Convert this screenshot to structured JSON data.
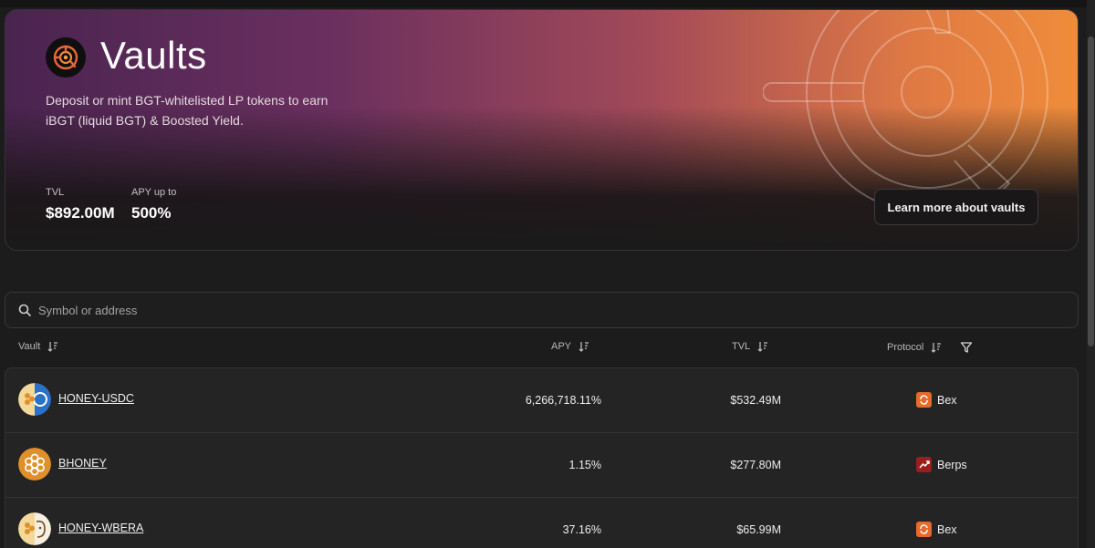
{
  "hero": {
    "title": "Vaults",
    "description": "Deposit or mint BGT-whitelisted LP tokens to earn iBGT (liquid BGT) & Boosted Yield.",
    "stats": [
      {
        "label": "TVL",
        "value": "$892.00M"
      },
      {
        "label": "APY up to",
        "value": "500%"
      }
    ],
    "learn_more_label": "Learn more about vaults",
    "logo_icon": "target-icon"
  },
  "search": {
    "placeholder": "Symbol or address",
    "value": ""
  },
  "table": {
    "columns": [
      {
        "label": "Vault",
        "icon": "sort-icon"
      },
      {
        "label": "APY",
        "icon": "sort-icon"
      },
      {
        "label": "TVL",
        "icon": "sort-icon"
      },
      {
        "label": "Protocol",
        "icon": "sort-icon",
        "extra_icon": "filter-icon"
      }
    ],
    "rows": [
      {
        "vault": "HONEY-USDC",
        "apy": "6,266,718.11%",
        "tvl": "$532.49M",
        "protocol": "Bex",
        "protocol_icon": "bex-icon",
        "protocol_color": "#e56a2c"
      },
      {
        "vault": "BHONEY",
        "apy": "1.15%",
        "tvl": "$277.80M",
        "protocol": "Berps",
        "protocol_icon": "berps-icon",
        "protocol_color": "#9b1d1d"
      },
      {
        "vault": "HONEY-WBERA",
        "apy": "37.16%",
        "tvl": "$65.99M",
        "protocol": "Bex",
        "protocol_icon": "bex-icon",
        "protocol_color": "#e56a2c"
      }
    ]
  },
  "colors": {
    "background": "#1c1c1c",
    "accent_orange": "#ef8c3a",
    "accent_purple": "#6a2f5f",
    "honey": "#e0902a"
  }
}
